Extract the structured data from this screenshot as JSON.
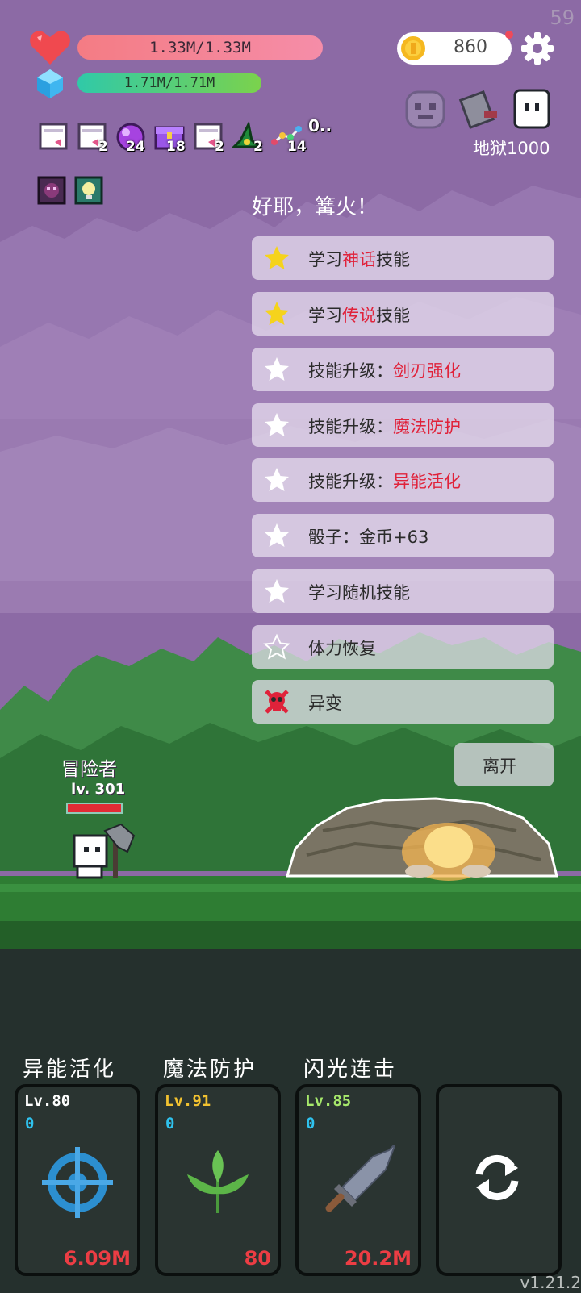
{
  "fps": "59",
  "hud": {
    "hp_text": "1.33M/1.33M",
    "mp_text": "1.71M/1.71M",
    "coins": "860",
    "area_label": "地狱1000"
  },
  "inventory": [
    {
      "icon": "scroll-icon",
      "count": ""
    },
    {
      "icon": "scroll-icon",
      "count": "2"
    },
    {
      "icon": "magic-orb-icon",
      "count": "24"
    },
    {
      "icon": "treasure-chest-icon",
      "count": "18"
    },
    {
      "icon": "scroll-icon",
      "count": "2"
    },
    {
      "icon": "witch-hat-icon",
      "count": "2"
    },
    {
      "icon": "dots-chain-icon",
      "count": "14"
    },
    {
      "icon": "more-icon",
      "count": "0.."
    }
  ],
  "event": {
    "title": "好耶，篝火！",
    "options": [
      {
        "star": "gold",
        "prefix": "学习",
        "highlight": "神话",
        "suffix": "技能"
      },
      {
        "star": "gold",
        "prefix": "学习",
        "highlight": "传说",
        "suffix": "技能"
      },
      {
        "star": "white",
        "prefix": "技能升级：",
        "highlight": "剑刃强化",
        "suffix": ""
      },
      {
        "star": "white",
        "prefix": "技能升级：",
        "highlight": "魔法防护",
        "suffix": ""
      },
      {
        "star": "white",
        "prefix": "技能升级：",
        "highlight": "异能活化",
        "suffix": ""
      },
      {
        "star": "white",
        "prefix": "骰子：金币+63",
        "highlight": "",
        "suffix": ""
      },
      {
        "star": "white",
        "prefix": "学习随机技能",
        "highlight": "",
        "suffix": ""
      },
      {
        "star": "outline",
        "prefix": "体力恢复",
        "highlight": "",
        "suffix": ""
      },
      {
        "star": "skull",
        "prefix": "异变",
        "highlight": "",
        "suffix": ""
      }
    ],
    "leave_label": "离开"
  },
  "hero": {
    "name": "冒险者",
    "level": "lv. 301"
  },
  "skills": [
    {
      "name": "异能活化",
      "level": "Lv.80",
      "level_color": "#ffffff",
      "count": "0",
      "value": "6.09M",
      "icon": "crosshair-icon"
    },
    {
      "name": "魔法防护",
      "level": "Lv.91",
      "level_color": "#f2c230",
      "count": "0",
      "value": "80",
      "icon": "leaf-icon"
    },
    {
      "name": "闪光连击",
      "level": "Lv.85",
      "level_color": "#a6e86b",
      "count": "0",
      "value": "20.2M",
      "icon": "sword-icon"
    }
  ],
  "refresh_icon": "refresh-icon",
  "version": "v1.21.2"
}
